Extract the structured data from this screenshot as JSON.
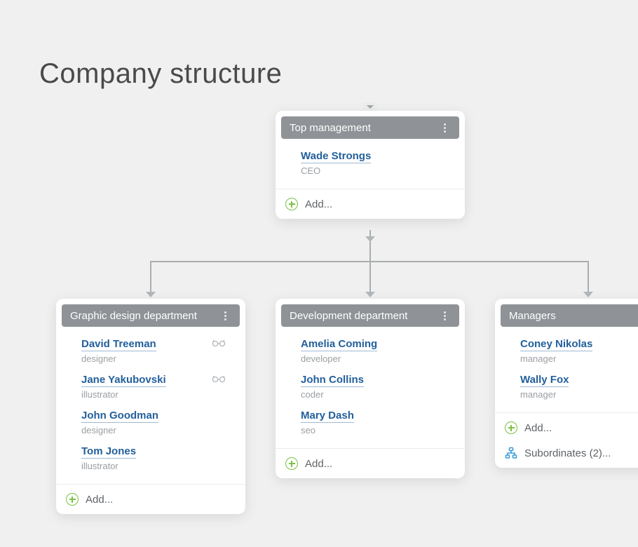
{
  "page": {
    "title": "Company structure"
  },
  "actions": {
    "add": "Add...",
    "subordinates_prefix": "Subordinates",
    "subordinates_count": "2"
  },
  "nodes": {
    "top": {
      "title": "Top management",
      "members": [
        {
          "name": "Wade Strongs",
          "role": "CEO"
        }
      ]
    },
    "design": {
      "title": "Graphic design department",
      "members": [
        {
          "name": "David Treeman",
          "role": "designer",
          "viewer": true
        },
        {
          "name": "Jane Yakubovski",
          "role": "illustrator",
          "viewer": true
        },
        {
          "name": "John Goodman",
          "role": "designer"
        },
        {
          "name": "Tom Jones",
          "role": "illustrator"
        }
      ]
    },
    "dev": {
      "title": "Development department",
      "members": [
        {
          "name": "Amelia Coming",
          "role": "developer"
        },
        {
          "name": "John Collins",
          "role": "coder"
        },
        {
          "name": "Mary Dash",
          "role": "seo"
        }
      ]
    },
    "managers": {
      "title": "Managers",
      "members": [
        {
          "name": "Coney Nikolas",
          "role": "manager"
        },
        {
          "name": "Wally Fox",
          "role": "manager"
        }
      ]
    }
  }
}
